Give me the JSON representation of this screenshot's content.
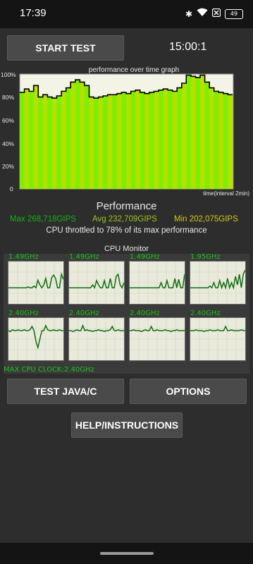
{
  "status_bar": {
    "time": "17:39",
    "icons": [
      "bluetooth-icon",
      "wifi-icon",
      "close-box-icon",
      "battery-icon"
    ],
    "battery_level": "49"
  },
  "controls": {
    "start_label": "START TEST",
    "timer": "15:00:1",
    "test_java_label": "TEST JAVA/C",
    "options_label": "OPTIONS",
    "help_label": "HELP/INSTRUCTIONS"
  },
  "performance_graph": {
    "title": "performance over time graph",
    "y_ticks": [
      "100%",
      "80%",
      "60%",
      "40%",
      "20%",
      "0"
    ],
    "x_label": "time(interval 2min)",
    "colors": {
      "high": "#7cf000",
      "low": "#b6e000",
      "line": "#000000",
      "background": "#f3f3e6"
    },
    "levels": [
      0.84,
      0.87,
      0.85,
      0.9,
      0.8,
      0.82,
      0.8,
      0.79,
      0.81,
      0.85,
      0.88,
      0.93,
      0.95,
      0.93,
      0.9,
      0.8,
      0.79,
      0.8,
      0.81,
      0.82,
      0.82,
      0.83,
      0.84,
      0.83,
      0.85,
      0.86,
      0.84,
      0.83,
      0.84,
      0.85,
      0.86,
      0.87,
      0.86,
      0.85,
      0.88,
      0.92,
      0.99,
      0.98,
      0.97,
      0.99,
      0.93,
      0.88,
      0.85,
      0.84,
      0.83,
      0.82
    ]
  },
  "performance": {
    "title": "Performance",
    "max": "Max 268,718GIPS",
    "avg": "Avg 232,709GIPS",
    "min": "Min 202,075GIPS",
    "throttle_note": "CPU throttled to 78% of its max performance",
    "colors": {
      "max": "#16b016",
      "avg": "#9cc41c",
      "min": "#d2c81c"
    }
  },
  "cpu_monitor": {
    "title": "CPU Monitor",
    "max_clock": "MAX CPU CLOCK:2.40GHz",
    "line_color": "#0e6e10",
    "cores": [
      {
        "freq": "1.49GHz",
        "levels": [
          0.62,
          0.62,
          0.62,
          0.62,
          0.62,
          0.62,
          0.62,
          0.62,
          0.62,
          0.62,
          0.6,
          0.62,
          0.62,
          0.58,
          0.62,
          0.44,
          0.55,
          0.62,
          0.55,
          0.4,
          0.62,
          0.62,
          0.38,
          0.32,
          0.4,
          0.62,
          0.62,
          0.3,
          0.42
        ]
      },
      {
        "freq": "1.49GHz",
        "levels": [
          0.62,
          0.62,
          0.62,
          0.62,
          0.62,
          0.62,
          0.62,
          0.62,
          0.62,
          0.62,
          0.62,
          0.62,
          0.55,
          0.62,
          0.45,
          0.55,
          0.62,
          0.62,
          0.45,
          0.62,
          0.62,
          0.4,
          0.62,
          0.62,
          0.35,
          0.3,
          0.55,
          0.62,
          0.5
        ]
      },
      {
        "freq": "1.49GHz",
        "levels": [
          0.62,
          0.62,
          0.62,
          0.62,
          0.62,
          0.62,
          0.62,
          0.62,
          0.62,
          0.62,
          0.62,
          0.62,
          0.62,
          0.62,
          0.62,
          0.62,
          0.5,
          0.62,
          0.62,
          0.45,
          0.62,
          0.62,
          0.62,
          0.4,
          0.62,
          0.42,
          0.62,
          0.62,
          0.3
        ]
      },
      {
        "freq": "1.95GHz",
        "levels": [
          0.62,
          0.62,
          0.62,
          0.62,
          0.62,
          0.62,
          0.62,
          0.62,
          0.62,
          0.62,
          0.58,
          0.62,
          0.5,
          0.62,
          0.62,
          0.45,
          0.62,
          0.5,
          0.62,
          0.4,
          0.62,
          0.5,
          0.62,
          0.35,
          0.55,
          0.3,
          0.62,
          0.3,
          0.2
        ]
      },
      {
        "freq": "2.40GHz",
        "levels": [
          0.3,
          0.32,
          0.28,
          0.3,
          0.3,
          0.28,
          0.3,
          0.3,
          0.28,
          0.3,
          0.3,
          0.28,
          0.2,
          0.3,
          0.55,
          0.7,
          0.5,
          0.3,
          0.3,
          0.18,
          0.28,
          0.3,
          0.3,
          0.28,
          0.3,
          0.3,
          0.28,
          0.3,
          0.3
        ]
      },
      {
        "freq": "2.40GHz",
        "levels": [
          0.3,
          0.3,
          0.32,
          0.3,
          0.28,
          0.3,
          0.3,
          0.18,
          0.3,
          0.28,
          0.3,
          0.3,
          0.32,
          0.3,
          0.3,
          0.28,
          0.3,
          0.3,
          0.32,
          0.3,
          0.3,
          0.28,
          0.2,
          0.3,
          0.3,
          0.28,
          0.3,
          0.3,
          0.3
        ]
      },
      {
        "freq": "2.40GHz",
        "levels": [
          0.3,
          0.3,
          0.28,
          0.3,
          0.3,
          0.3,
          0.32,
          0.3,
          0.28,
          0.3,
          0.3,
          0.2,
          0.3,
          0.3,
          0.28,
          0.3,
          0.3,
          0.3,
          0.28,
          0.3,
          0.3,
          0.32,
          0.3,
          0.3,
          0.28,
          0.3,
          0.3,
          0.3,
          0.3
        ]
      },
      {
        "freq": "2.40GHz",
        "levels": [
          0.3,
          0.3,
          0.3,
          0.28,
          0.3,
          0.3,
          0.3,
          0.32,
          0.3,
          0.3,
          0.28,
          0.3,
          0.3,
          0.3,
          0.28,
          0.3,
          0.3,
          0.3,
          0.2,
          0.3,
          0.3,
          0.28,
          0.3,
          0.3,
          0.3,
          0.3,
          0.28,
          0.3,
          0.3
        ]
      }
    ]
  }
}
